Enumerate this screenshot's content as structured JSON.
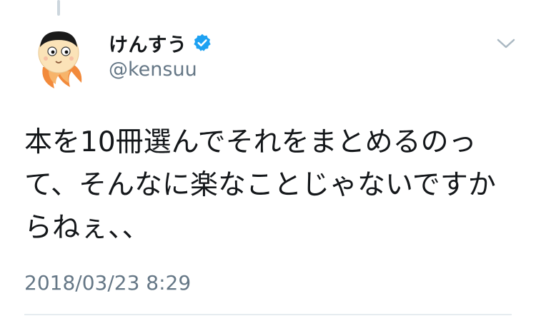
{
  "tweet": {
    "display_name": "けんすう",
    "handle": "@kensuu",
    "text": "本を10冊選んでそれをまとめるのって、そんなに楽なことじゃないですからねぇ、、",
    "timestamp": "2018/03/23 8:29",
    "verified": true
  },
  "icons": {
    "avatar": "avatar-illustration",
    "verified": "verified-badge-icon",
    "menu": "chevron-down-icon"
  },
  "colors": {
    "name": "#14171a",
    "secondary": "#657786",
    "verified": "#1da1f2",
    "thread_line": "#ccd6dd"
  }
}
